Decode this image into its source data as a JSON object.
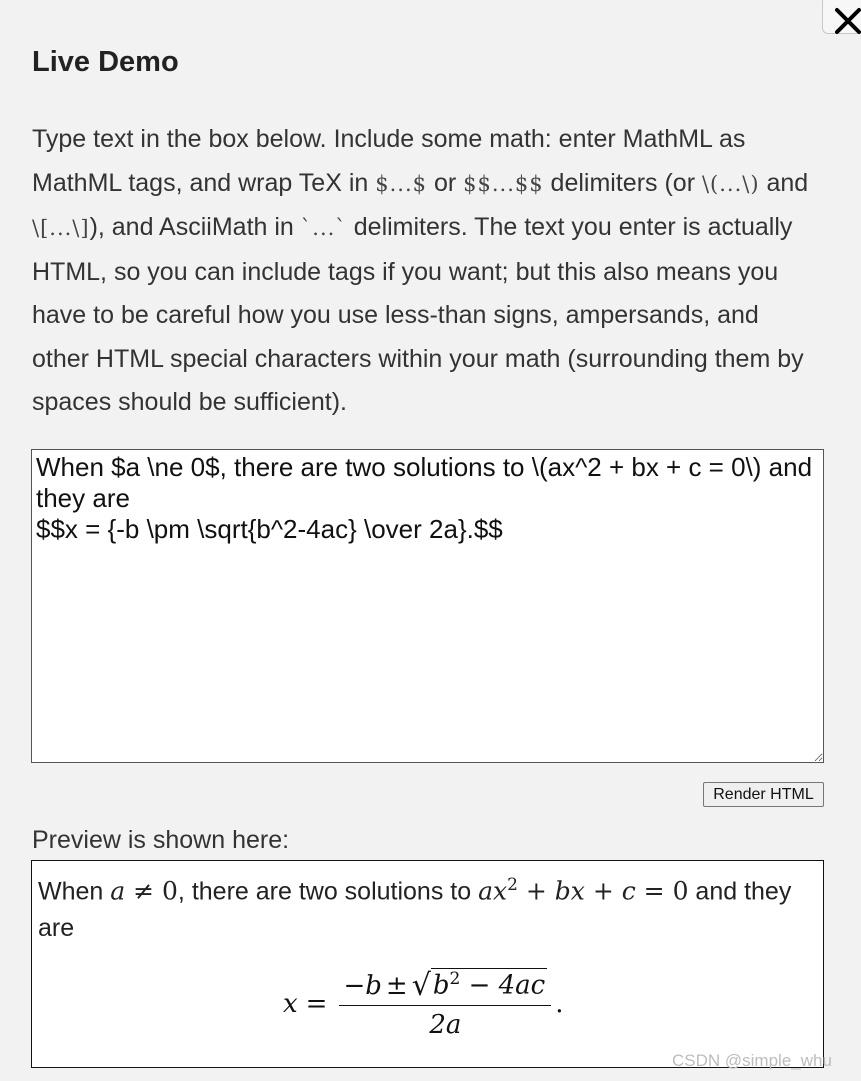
{
  "dialog": {
    "title": "Live Demo",
    "close_label": "✕"
  },
  "intro": {
    "p1": "Type text in the box below. Include some math: enter MathML as MathML tags, and wrap TeX in ",
    "tex_inline": "$...$",
    "p2": " or ",
    "tex_display": "$$...$$",
    "p3": " delimiters (or ",
    "tex_paren": "\\(...\\)",
    "p4": " and ",
    "tex_bracket": "\\[...\\]",
    "p5": "), and AsciiMath in ",
    "ascii_delim": "`...`",
    "p6": " delimiters. The text you enter is actually HTML, so you can include tags if you want; but this also means you have to be careful how you use less-than signs, ampersands, and other HTML special characters within your math (surrounding them by spaces should be sufficient)."
  },
  "editor": {
    "value": "When $a \\ne 0$, there are two solutions to \\(ax^2 + bx + c = 0\\) and they are\n$$x = {-b \\pm \\sqrt{b^2-4ac} \\over 2a}.$$"
  },
  "render_button": {
    "label": "Render HTML"
  },
  "preview": {
    "label": "Preview is shown here:",
    "t1": "When ",
    "m1_a": "a",
    "m1_ne": " ≠ ",
    "m1_0": "0",
    "t2": ", there are two solutions to ",
    "m2_ax": "ax",
    "m2_sup": "2",
    "m2_rest": " + bx + c",
    "m2_eq": " = ",
    "m2_0": "0",
    "t3": " and they are",
    "disp_x": "x",
    "disp_eq": " = ",
    "num_minus_b": "−b",
    "num_pm": " ± ",
    "sqrt_sign": "√",
    "sqrt_b": "b",
    "sqrt_sup": "2",
    "sqrt_rest": " − 4ac",
    "den": "2a",
    "period": "."
  },
  "watermark": "CSDN @simple_whu"
}
